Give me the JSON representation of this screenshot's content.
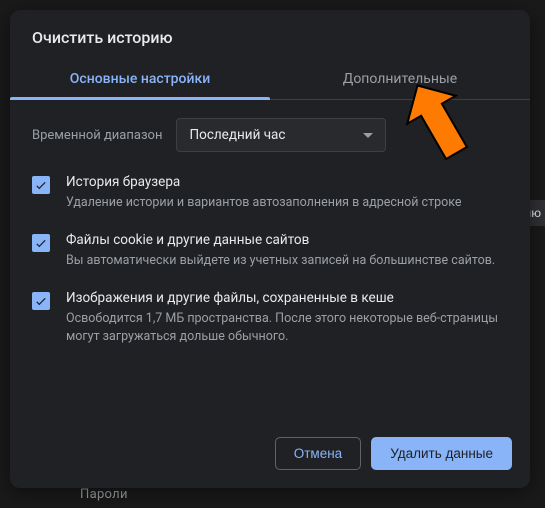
{
  "dialog": {
    "title": "Очистить историю",
    "tabs": {
      "basic": "Основные настройки",
      "advanced": "Дополнительные"
    },
    "time": {
      "label": "Временной диапазон",
      "value": "Последний час"
    },
    "options": [
      {
        "title": "История браузера",
        "desc": "Удаление истории и вариантов автозаполнения в адресной строке"
      },
      {
        "title": "Файлы cookie и другие данные сайтов",
        "desc": "Вы автоматически выйдете из учетных записей на большинстве сайтов."
      },
      {
        "title": "Изображения и другие файлы, сохраненные в кеше",
        "desc": "Освободится 1,7 МБ пространства. После этого некоторые веб-страницы могут загружаться дольше обычного."
      }
    ],
    "buttons": {
      "cancel": "Отмена",
      "confirm": "Удалить данные"
    }
  },
  "background": {
    "item": "Пароли",
    "side": "лю"
  }
}
